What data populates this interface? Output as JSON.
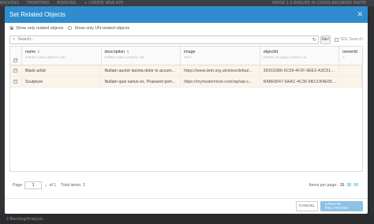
{
  "background": {
    "topbar_items": [
      "BACKEND",
      "FRONTEND",
      "MISSIONS",
      "+ CREATE NEW APP",
      "PARSE 1.9 EARLIER IN CROSS-BROWSER INVITE"
    ],
    "bottom_text": "2 Backlog/Analysis"
  },
  "modal": {
    "title": "Set Related Objects",
    "close_icon": "close-icon",
    "filter": {
      "options": [
        {
          "label": "Show only related objects",
          "selected": true
        },
        {
          "label": "Show only UN-related objects",
          "selected": false
        }
      ]
    },
    "search": {
      "placeholder": "Search...",
      "go_label": "Go!",
      "sql_label": "SQL Search",
      "sql_checked": false
    },
    "table": {
      "columns": [
        {
          "name": "name",
          "type": "STRING | MAX LENGTH: 250"
        },
        {
          "name": "description",
          "type": "STRING | MAX LENGTH: 255"
        },
        {
          "name": "image",
          "type": "TEXT"
        },
        {
          "name": "objectId",
          "type": "STRING_ID | MAX LENGTH: 36"
        },
        {
          "name": "ownerId",
          "type": "S"
        }
      ],
      "rows": [
        {
          "checked": true,
          "name": "Black artist",
          "description": "Nullam auctor lacinia dolor in accum...",
          "image": "https://www.iwm.org.uk/sites/defaul...",
          "objectId": "3D916386-6C59-4F2F-9EE2-A3C5138...",
          "ownerId": ""
        },
        {
          "checked": true,
          "name": "Sculpture",
          "description": "Nullam quis varius ex. Praesent port...",
          "image": "https://mymodernmet.com/wp/wp-c...",
          "objectId": "BA8E8947-6AAC-4C36-9B13-B4E656...",
          "ownerId": ""
        }
      ]
    },
    "pager": {
      "page_label": "Page",
      "page_value": "1",
      "of_label": "of 1",
      "total_label": "Total items: 2",
      "items_per_page_label": "Items per page:",
      "per_page_options": [
        "15",
        "30",
        "50"
      ],
      "per_page_selected": "15"
    },
    "footer": {
      "cancel_label": "CANCEL",
      "update_label": "UPDATE RELATIONS"
    }
  },
  "colors": {
    "header": "#2f8dcf",
    "row_highlight": "#fcf4e8",
    "update_button": "#8dc1e6"
  }
}
